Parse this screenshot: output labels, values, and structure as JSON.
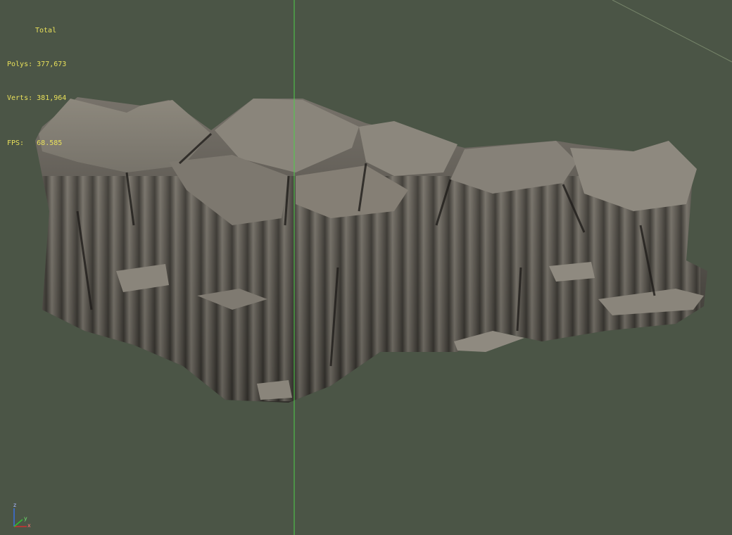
{
  "viewport": {
    "stats": {
      "header": "Total",
      "polys_label": "Polys:",
      "polys_value": "377,673",
      "verts_label": "Verts:",
      "verts_value": "381,964",
      "fps_label": "FPS:",
      "fps_value": "68.585"
    },
    "gizmo": {
      "z_label": "z",
      "x_label": "x",
      "y_label": "y"
    }
  },
  "colors": {
    "background": "#4b5546",
    "stats_text": "#e8e05a",
    "grid_axis_vertical": "#4fd04a",
    "rock_light": "#9c9589",
    "rock_mid": "#6e6a62",
    "rock_dark": "#2d2b27"
  }
}
